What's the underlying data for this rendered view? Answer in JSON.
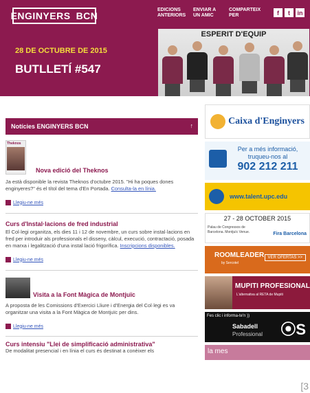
{
  "header": {
    "logo_left": "ENGINYERS",
    "logo_right": "BCN",
    "nav": [
      "EDICIONS ANTERIORS",
      "ENVIAR A UN AMIC",
      "COMPARTEIX PER"
    ],
    "social": [
      "f",
      "t",
      "in"
    ],
    "date": "28 DE OCTUBRE DE 2015",
    "bulletin": "BUTLLETÍ #547",
    "hero_title": "ESPERIT D'EQUIP"
  },
  "section": {
    "title": "Notícies ENGINYERS BCN",
    "arrow": "↑"
  },
  "articles": [
    {
      "thumb_caption": "Theknos",
      "title": "Nova edició del Theknos",
      "text": "Ja està disponible la revista Theknos d'octubre 2015. \"Hi ha poques dones enginyeres?\" és el títol del tema d'En Portada.",
      "link": "Consulta-la en línia.",
      "more": "Llegiu-ne més"
    },
    {
      "title": "Curs d'Instal·lacions de fred industrial",
      "text": "El Col·legi organitza, els dies 11 i 12 de novembre, un curs sobre instal·lacions en fred per introduir als professionals el disseny, càlcul, execució, contractació, posada en marxa i legalització d'una instal·lació frigorífica.",
      "link": "Inscripcions disponibles.",
      "more": "Llegiu-ne més"
    },
    {
      "title": "Visita a la Font Màgica de Montjuïc",
      "text": "A proposta de les Comissions d'Exercici Lliure i d'Energia del Col·legi es va organitzar una visita a la Font Màgica de Montjuïc per dins.",
      "more": "Llegiu-ne més"
    },
    {
      "title": "Curs intensiu \"Llei de simplificació administrativa\"",
      "text": "De modalitat presencial i en línia el curs és destinat a conèixer els"
    }
  ],
  "ads": {
    "caixa": "Caixa d'Enginyers",
    "upc_text": "Per a més informació, truqueu-nos al",
    "upc_phone": "902 212 211",
    "talent": "www.talent.upc.edu",
    "fira_dates": "27 - 28 OCTOBER 2015",
    "fira_venue": "Palau de Congressos de Barcelona. Montjuïc Venue.",
    "fira_brand": "Fira Barcelona",
    "roomleader": "ROOMLEADER",
    "roomleader_sub": "by Sercotel",
    "roomleader_btn": "VER OFERTAS >>",
    "mupiti_title": "MUPITI PROFESIONAL",
    "mupiti_sub": "L'alternativa al RETA de Mupiti",
    "sabadell_top": "Fes clic i informa-te'n ))",
    "sabadell_name": "Sabadell",
    "sabadell_sub": "Professional",
    "last_text": "la mes"
  },
  "corner": "[3",
  "colors": {
    "brand": "#8c1a4f",
    "date": "#f4dd3c",
    "link": "#3355bb"
  }
}
